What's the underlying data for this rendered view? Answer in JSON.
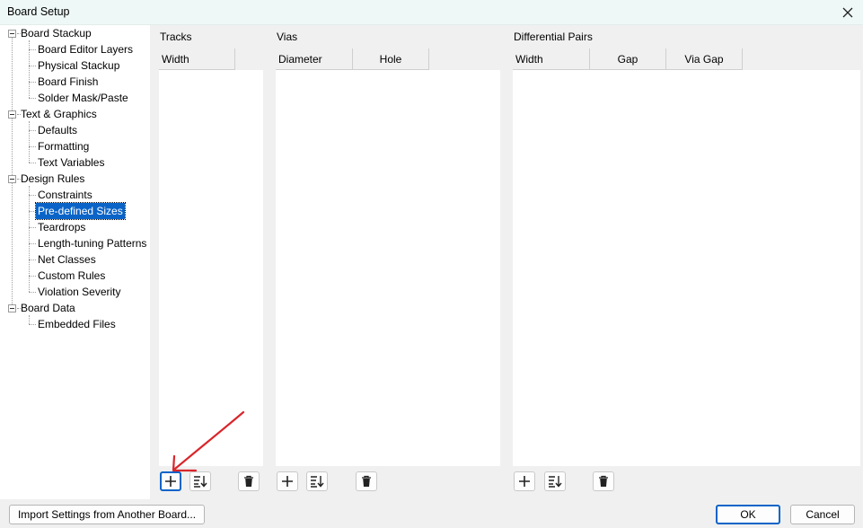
{
  "window": {
    "title": "Board Setup"
  },
  "tree": {
    "groups": [
      {
        "label": "Board Stackup",
        "children": [
          "Board Editor Layers",
          "Physical Stackup",
          "Board Finish",
          "Solder Mask/Paste"
        ]
      },
      {
        "label": "Text & Graphics",
        "children": [
          "Defaults",
          "Formatting",
          "Text Variables"
        ]
      },
      {
        "label": "Design Rules",
        "children": [
          "Constraints",
          "Pre-defined Sizes",
          "Teardrops",
          "Length-tuning Patterns",
          "Net Classes",
          "Custom Rules",
          "Violation Severity"
        ]
      },
      {
        "label": "Board Data",
        "children": [
          "Embedded Files"
        ]
      }
    ],
    "selected": "Pre-defined Sizes"
  },
  "tracks": {
    "label": "Tracks",
    "columns": [
      "Width"
    ]
  },
  "vias": {
    "label": "Vias",
    "columns": [
      "Diameter",
      "Hole"
    ]
  },
  "diff_pairs": {
    "label": "Differential Pairs",
    "columns": [
      "Width",
      "Gap",
      "Via Gap"
    ]
  },
  "buttons": {
    "import": "Import Settings from Another Board...",
    "ok": "OK",
    "cancel": "Cancel"
  },
  "annotation": {
    "color": "#d9262b"
  },
  "colors": {
    "selection": "#0a64c8",
    "panel": "#f0f0f0"
  }
}
